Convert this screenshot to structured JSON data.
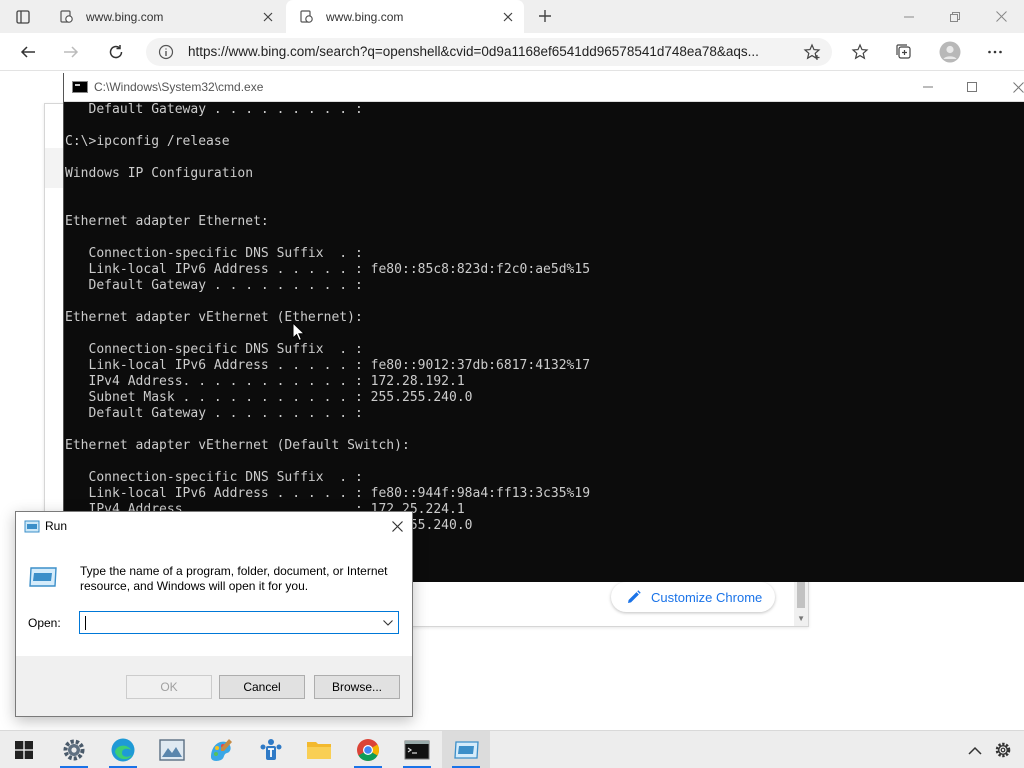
{
  "browser": {
    "tabs": [
      {
        "title": "www.bing.com",
        "active": false
      },
      {
        "title": "www.bing.com",
        "active": true
      }
    ],
    "url": "https://www.bing.com/search?q=openshell&cvid=0d9a1168ef6541dd96578541d748ea78&aqs...",
    "customize_label": "Customize Chrome"
  },
  "cmd": {
    "title": "C:\\Windows\\System32\\cmd.exe",
    "lines": [
      "   Default Gateway . . . . . . . . . :",
      "",
      "C:\\>ipconfig /release",
      "",
      "Windows IP Configuration",
      "",
      "",
      "Ethernet adapter Ethernet:",
      "",
      "   Connection-specific DNS Suffix  . :",
      "   Link-local IPv6 Address . . . . . : fe80::85c8:823d:f2c0:ae5d%15",
      "   Default Gateway . . . . . . . . . :",
      "",
      "Ethernet adapter vEthernet (Ethernet):",
      "",
      "   Connection-specific DNS Suffix  . :",
      "   Link-local IPv6 Address . . . . . : fe80::9012:37db:6817:4132%17",
      "   IPv4 Address. . . . . . . . . . . : 172.28.192.1",
      "   Subnet Mask . . . . . . . . . . . : 255.255.240.0",
      "   Default Gateway . . . . . . . . . :",
      "",
      "Ethernet adapter vEthernet (Default Switch):",
      "",
      "   Connection-specific DNS Suffix  . :",
      "   Link-local IPv6 Address . . . . . : fe80::944f:98a4:ff13:3c35%19",
      "   IPv4 Address. . . . . . . . . . . : 172.25.224.1",
      "   Subnet Mask . . . . . . . . . . . : 255.255.240.0"
    ]
  },
  "run": {
    "title": "Run",
    "description": "Type the name of a program, folder, document, or Internet resource, and Windows will open it for you.",
    "open_label": "Open:",
    "open_value": "",
    "ok_label": "OK",
    "cancel_label": "Cancel",
    "browse_label": "Browse..."
  },
  "taskbar": {
    "items": [
      "start-icon",
      "settings-icon",
      "edge-icon",
      "photos-icon",
      "paint-icon",
      "teams-icon",
      "file-explorer-icon",
      "chrome-icon",
      "cmd-icon",
      "run-icon"
    ],
    "tray": [
      "show-hidden-icons-chevron",
      "settings-gear-icon"
    ]
  },
  "colors": {
    "accent": "#0078d7",
    "console_bg": "#0c0c0c",
    "console_fg": "#cccccc",
    "link": "#1a73e8"
  }
}
